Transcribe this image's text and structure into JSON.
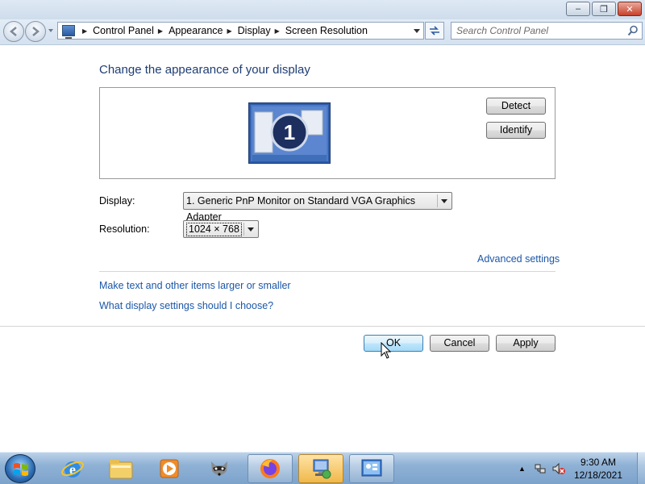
{
  "window": {
    "minimize_label": "–",
    "restore_label": "❐"
  },
  "addressbar": {
    "breadcrumbs": [
      "Control Panel",
      "Appearance",
      "Display",
      "Screen Resolution"
    ],
    "search_placeholder": "Search Control Panel"
  },
  "content": {
    "heading": "Change the appearance of your display",
    "monitor_number": "1",
    "detect_label": "Detect",
    "identify_label": "Identify",
    "display_label": "Display:",
    "display_value": "1. Generic PnP Monitor on Standard VGA Graphics Adapter",
    "resolution_label": "Resolution:",
    "resolution_value": "1024 × 768",
    "advanced_settings": "Advanced settings",
    "link_text_size": "Make text and other items larger or smaller",
    "link_display_help": "What display settings should I choose?"
  },
  "dialog_buttons": {
    "ok": "OK",
    "cancel": "Cancel",
    "apply": "Apply"
  },
  "taskbar": {
    "time": "9:30 AM",
    "date": "12/18/2021",
    "pinned": [
      "internet-explorer-icon",
      "file-explorer-icon",
      "media-player-icon",
      "raccoon-app-icon",
      "firefox-icon",
      "remote-desktop-icon",
      "control-panel-icon"
    ]
  },
  "colors": {
    "heading": "#1e3d73",
    "link": "#1b57a8",
    "taskbar": "#8fb1d5"
  }
}
